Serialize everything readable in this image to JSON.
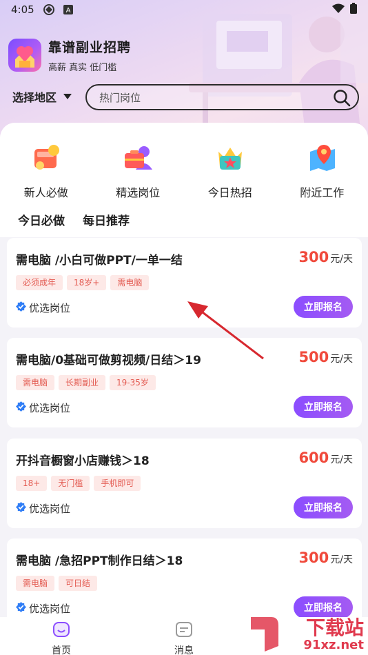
{
  "status_bar": {
    "time": "4:05",
    "app_badge": "A"
  },
  "brand": {
    "title": "靠谱副业招聘",
    "subtitle": "高薪 真实 低门槛"
  },
  "region": {
    "label": "选择地区"
  },
  "search": {
    "placeholder": "热门岗位"
  },
  "quick_menu": [
    {
      "label": "新人必做",
      "icon": "wallet-coin-icon"
    },
    {
      "label": "精选岗位",
      "icon": "briefcase-person-icon"
    },
    {
      "label": "今日热招",
      "icon": "crown-star-icon"
    },
    {
      "label": "附近工作",
      "icon": "map-pin-icon"
    }
  ],
  "tabs": [
    {
      "label": "今日必做",
      "active": true
    },
    {
      "label": "每日推荐",
      "active": false
    }
  ],
  "jobs": [
    {
      "title": "需电脑 /小白可做PPT/一单一结",
      "salary": "300",
      "unit": "元/天",
      "tags": [
        "必须成年",
        "18岁+",
        "需电脑"
      ],
      "badge": "优选岗位",
      "button": "立即报名"
    },
    {
      "title": "需电脑/0基础可做剪视频/日结＞19",
      "salary": "500",
      "unit": "元/天",
      "tags": [
        "需电脑",
        "长期副业",
        "19-35岁"
      ],
      "badge": "优选岗位",
      "button": "立即报名"
    },
    {
      "title": "开抖音橱窗小店赚钱＞18",
      "salary": "600",
      "unit": "元/天",
      "tags": [
        "18+",
        "无门槛",
        "手机即可"
      ],
      "badge": "优选岗位",
      "button": "立即报名"
    },
    {
      "title": "需电脑 /急招PPT制作日结＞18",
      "salary": "300",
      "unit": "元/天",
      "tags": [
        "需电脑",
        "可日结"
      ],
      "badge": "优选岗位",
      "button": "立即报名"
    }
  ],
  "bottom_nav": [
    {
      "label": "首页",
      "icon": "home-icon"
    },
    {
      "label": "消息",
      "icon": "message-icon"
    }
  ],
  "watermark": {
    "big": "下载站",
    "small": "91xz.net"
  },
  "colors": {
    "accent": "#8b4dff",
    "salary": "#f04a3c",
    "tag_bg": "#fde9e7",
    "arrow": "#d7282f"
  }
}
